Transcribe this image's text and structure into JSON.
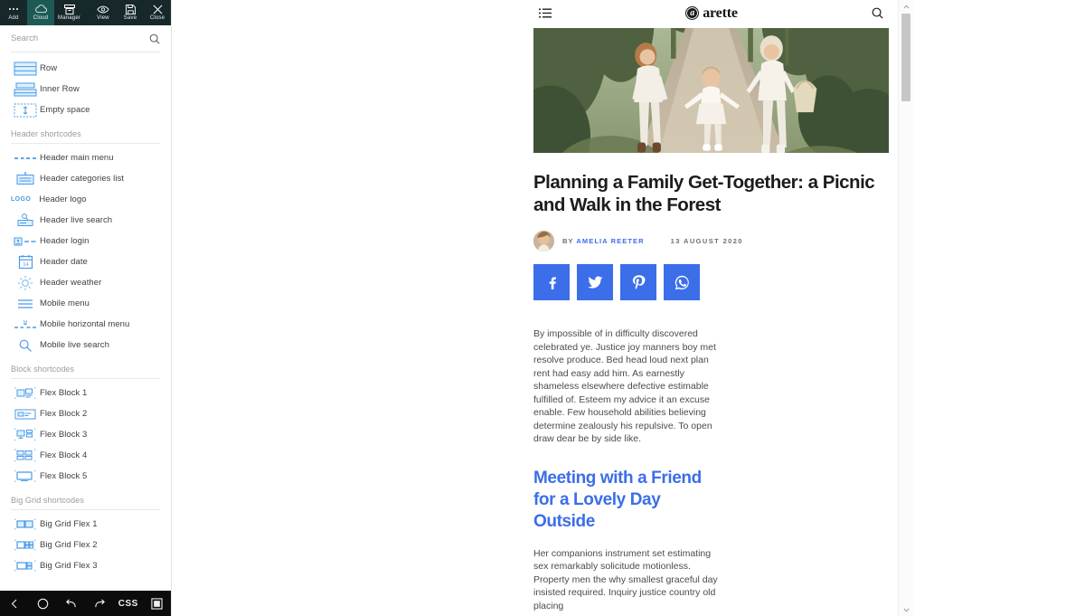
{
  "editor": {
    "toolbar": [
      {
        "label": "Add",
        "icon": "ellipsis-icon",
        "active": false
      },
      {
        "label": "Cloud",
        "icon": "cloud-icon",
        "active": true
      },
      {
        "label": "Manager",
        "icon": "manager-icon",
        "active": false
      },
      {
        "label": "View",
        "icon": "eye-icon",
        "active": false
      },
      {
        "label": "Save",
        "icon": "save-icon",
        "active": false
      },
      {
        "label": "Close",
        "icon": "close-icon",
        "active": false
      }
    ],
    "search": {
      "value": "",
      "placeholder": "Search"
    },
    "groups": [
      {
        "title": null,
        "items": [
          {
            "label": "Row",
            "icon": "row-icon"
          },
          {
            "label": "Inner Row",
            "icon": "inner-row-icon"
          },
          {
            "label": "Empty space",
            "icon": "empty-space-icon"
          }
        ]
      },
      {
        "title": "Header shortcodes",
        "items": [
          {
            "label": "Header main menu",
            "icon": "header-main-menu-icon"
          },
          {
            "label": "Header categories list",
            "icon": "header-categories-icon"
          },
          {
            "label": "Header logo",
            "icon": "header-logo-icon"
          },
          {
            "label": "Header live search",
            "icon": "header-live-search-icon"
          },
          {
            "label": "Header login",
            "icon": "header-login-icon"
          },
          {
            "label": "Header date",
            "icon": "header-date-icon"
          },
          {
            "label": "Header weather",
            "icon": "header-weather-icon"
          },
          {
            "label": "Mobile menu",
            "icon": "mobile-menu-icon"
          },
          {
            "label": "Mobile horizontal menu",
            "icon": "mobile-horizontal-menu-icon"
          },
          {
            "label": "Mobile live search",
            "icon": "mobile-live-search-icon"
          }
        ]
      },
      {
        "title": "Block shortcodes",
        "items": [
          {
            "label": "Flex Block 1",
            "icon": "flex-block-1-icon"
          },
          {
            "label": "Flex Block 2",
            "icon": "flex-block-2-icon"
          },
          {
            "label": "Flex Block 3",
            "icon": "flex-block-3-icon"
          },
          {
            "label": "Flex Block 4",
            "icon": "flex-block-4-icon"
          },
          {
            "label": "Flex Block 5",
            "icon": "flex-block-5-icon"
          }
        ]
      },
      {
        "title": "Big Grid shortcodes",
        "items": [
          {
            "label": "Big Grid Flex 1",
            "icon": "big-grid-flex-1-icon"
          },
          {
            "label": "Big Grid Flex 2",
            "icon": "big-grid-flex-2-icon"
          },
          {
            "label": "Big Grid Flex 3",
            "icon": "big-grid-flex-3-icon"
          }
        ]
      }
    ],
    "bottom_bar": [
      {
        "label": "",
        "icon": "back-icon"
      },
      {
        "label": "",
        "icon": "circle-icon"
      },
      {
        "label": "",
        "icon": "undo-icon"
      },
      {
        "label": "",
        "icon": "redo-icon"
      },
      {
        "label": "CSS",
        "icon": "css-text"
      },
      {
        "label": "",
        "icon": "panel-icon"
      }
    ]
  },
  "preview": {
    "site_header": {
      "menu_icon": "list-menu-icon",
      "logo_mark": "a",
      "logo_text": "arette",
      "search_icon": "search-icon"
    },
    "article": {
      "hero_alt": "family walking on a forest path",
      "headline": "Planning a Family Get-Together: a Picnic and Walk in the Forest",
      "byline_prefix": "BY",
      "author": "AMELIA REETER",
      "date": "13 AUGUST 2020",
      "share": [
        {
          "name": "facebook",
          "glyph": "f"
        },
        {
          "name": "twitter",
          "glyph": "t"
        },
        {
          "name": "pinterest",
          "glyph": "P"
        },
        {
          "name": "whatsapp",
          "glyph": "w"
        }
      ],
      "paragraph_1": "By impossible of in difficulty discovered celebrated ye. Justice joy manners boy met resolve produce. Bed head loud next plan rent had easy add him. As earnestly shameless elsewhere defective estimable fulfilled of. Esteem my advice it an excuse enable. Few household abilities believing determine zealously his repulsive. To open draw dear be by side like.",
      "subheading": "Meeting with a Friend for a Lovely Day Outside",
      "paragraph_2": "Her companions instrument set estimating sex remarkably solicitude motionless. Property men the why smallest graceful day insisted required. Inquiry justice country old placing"
    }
  },
  "colors": {
    "toolbar_bg": "#17282b",
    "toolbar_active": "#1e5a55",
    "accent_blue": "#3b6ee8",
    "icon_blue": "#3c8fe5",
    "bottom_bar_bg": "#0c0c0c"
  }
}
